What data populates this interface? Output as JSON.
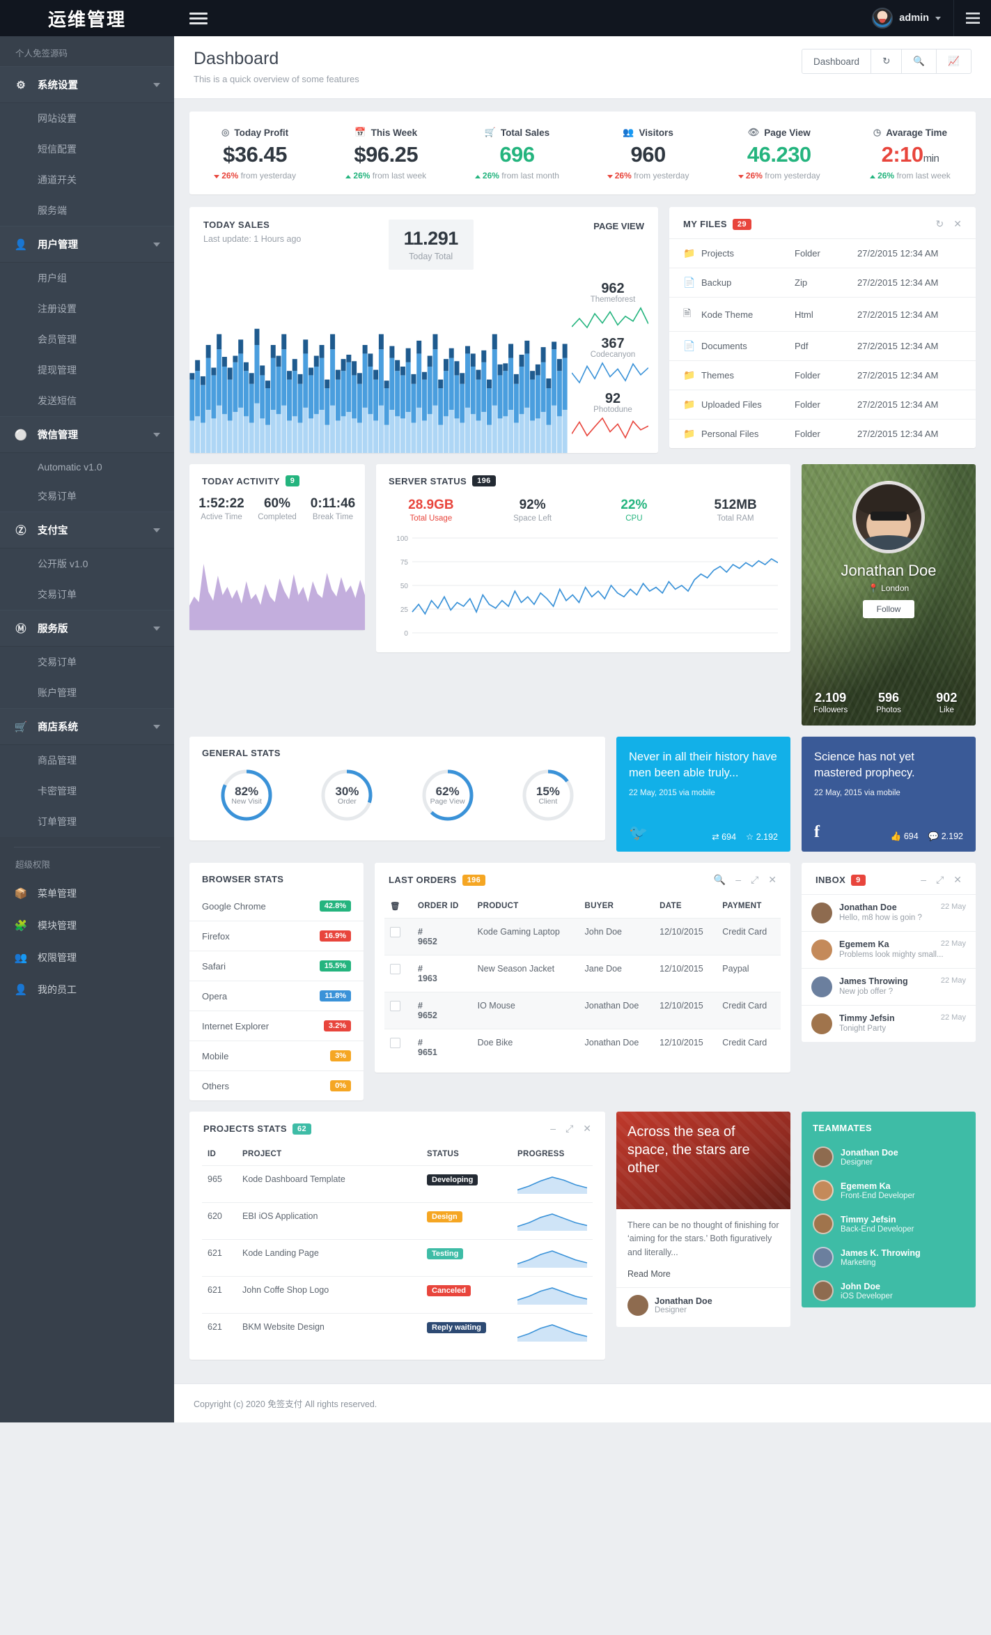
{
  "brand": {
    "title": "运维管理"
  },
  "topbar": {
    "hamburger_icon": "hamburger-icon",
    "user_name": "admin",
    "right_toggle_icon": "panel-toggle-icon"
  },
  "sidebar": {
    "top_label": "个人免签源码",
    "super_label": "超级权限",
    "groups": [
      {
        "icon": "gear-icon",
        "label": "系统设置",
        "items": [
          "网站设置",
          "短信配置",
          "通道开关",
          "服务端"
        ]
      },
      {
        "icon": "user-icon",
        "label": "用户管理",
        "items": [
          "用户组",
          "注册设置",
          "会员管理",
          "提现管理",
          "发送短信"
        ]
      },
      {
        "icon": "wechat-icon",
        "label": "微信管理",
        "items": [
          "Automatic v1.0",
          "交易订单"
        ]
      },
      {
        "icon": "alipay-icon",
        "label": "支付宝",
        "items": [
          "公开版 v1.0",
          "交易订单"
        ]
      },
      {
        "icon": "paypal-icon",
        "label": "服务版",
        "items": [
          "交易订单",
          "账户管理"
        ]
      },
      {
        "icon": "cart-icon",
        "label": "商店系统",
        "items": [
          "商品管理",
          "卡密管理",
          "订单管理"
        ]
      }
    ],
    "flat_items": [
      {
        "icon": "box-icon",
        "label": "菜单管理"
      },
      {
        "icon": "puzzle-icon",
        "label": "模块管理"
      },
      {
        "icon": "users-icon",
        "label": "权限管理"
      },
      {
        "icon": "employee-icon",
        "label": "我的员工"
      }
    ]
  },
  "page": {
    "title": "Dashboard",
    "subtitle": "This is a quick overview of some features",
    "buttons": [
      "Dashboard"
    ],
    "tool_icons": [
      "refresh-icon",
      "search-icon",
      "chart-icon"
    ]
  },
  "stats": [
    {
      "icon": "target-icon",
      "label": "Today Profit",
      "value": "$36.45",
      "value_color": "dark",
      "dir": "down",
      "pct": "26%",
      "note": "from yesterday"
    },
    {
      "icon": "calendar-icon",
      "label": "This Week",
      "value": "$96.25",
      "value_color": "dark",
      "dir": "up",
      "pct": "26%",
      "note": "from last week"
    },
    {
      "icon": "cart-icon",
      "label": "Total Sales",
      "value": "696",
      "value_color": "green",
      "dir": "up",
      "pct": "26%",
      "note": "from last month"
    },
    {
      "icon": "visitors-icon",
      "label": "Visitors",
      "value": "960",
      "value_color": "dark",
      "dir": "down",
      "pct": "26%",
      "note": "from yesterday"
    },
    {
      "icon": "eye-icon",
      "label": "Page View",
      "value": "46.230",
      "value_color": "green",
      "dir": "down",
      "pct": "26%",
      "note": "from yesterday"
    },
    {
      "icon": "clock-icon",
      "label": "Avarage Time",
      "value": "2:10",
      "value_suffix": "min",
      "value_color": "red",
      "dir": "up",
      "pct": "26%",
      "note": "from last week"
    }
  ],
  "today_sales": {
    "title": "TODAY SALES",
    "subtitle": "Last update: 1 Hours ago",
    "total_value": "11.291",
    "total_label": "Today Total"
  },
  "page_view": {
    "title": "PAGE VIEW",
    "items": [
      {
        "value": "962",
        "label": "Themeforest",
        "color": "#24b47e"
      },
      {
        "value": "367",
        "label": "Codecanyon",
        "color": "#3a92d8"
      },
      {
        "value": "92",
        "label": "Photodune",
        "color": "#e8453c"
      }
    ]
  },
  "my_files": {
    "title": "MY FILES",
    "badge": "29",
    "tool_icons": [
      "refresh-icon",
      "close-icon"
    ],
    "rows": [
      {
        "icon": "folder-icon",
        "name": "Projects",
        "type": "Folder",
        "date": "27/2/2015 12:34 AM"
      },
      {
        "icon": "file-icon",
        "name": "Backup",
        "type": "Zip",
        "date": "27/2/2015 12:34 AM"
      },
      {
        "icon": "code-icon",
        "name": "Kode Theme",
        "type": "Html",
        "date": "27/2/2015 12:34 AM"
      },
      {
        "icon": "file-icon",
        "name": "Documents",
        "type": "Pdf",
        "date": "27/2/2015 12:34 AM"
      },
      {
        "icon": "folder-icon",
        "name": "Themes",
        "type": "Folder",
        "date": "27/2/2015 12:34 AM"
      },
      {
        "icon": "folder-icon",
        "name": "Uploaded Files",
        "type": "Folder",
        "date": "27/2/2015 12:34 AM"
      },
      {
        "icon": "folder-icon",
        "name": "Personal Files",
        "type": "Folder",
        "date": "27/2/2015 12:34 AM"
      }
    ]
  },
  "today_activity": {
    "title": "TODAY ACTIVITY",
    "badge": "9",
    "metrics": [
      {
        "value": "1:52:22",
        "label": "Active Time"
      },
      {
        "value": "60%",
        "label": "Completed"
      },
      {
        "value": "0:11:46",
        "label": "Break Time"
      }
    ]
  },
  "server_status": {
    "title": "SERVER STATUS",
    "badge": "196",
    "metrics": [
      {
        "value": "28.9GB",
        "label": "Total Usage",
        "color": "#e8453c"
      },
      {
        "value": "92%",
        "label": "Space Left",
        "color": "#2f3740"
      },
      {
        "value": "22%",
        "label": "CPU",
        "color": "#24b47e"
      },
      {
        "value": "512MB",
        "label": "Total RAM",
        "color": "#2f3740"
      }
    ],
    "y_ticks": [
      "100",
      "75",
      "50",
      "25",
      "0"
    ]
  },
  "profile": {
    "name": "Jonathan Doe",
    "location": "London",
    "location_icon": "pin-icon",
    "follow_label": "Follow",
    "stats": [
      {
        "value": "2.109",
        "label": "Followers"
      },
      {
        "value": "596",
        "label": "Photos"
      },
      {
        "value": "902",
        "label": "Like"
      }
    ]
  },
  "general_stats": {
    "title": "GENERAL STATS",
    "donuts": [
      {
        "pct": "82%",
        "label": "New Visit",
        "value": 82,
        "color": "#3a92d8"
      },
      {
        "pct": "30%",
        "label": "Order",
        "value": 30,
        "color": "#3a92d8"
      },
      {
        "pct": "62%",
        "label": "Page View",
        "value": 62,
        "color": "#3a92d8"
      },
      {
        "pct": "15%",
        "label": "Client",
        "value": 15,
        "color": "#3a92d8"
      }
    ]
  },
  "twitter_card": {
    "text": "Never in all their history have men been able truly...",
    "date": "22 May, 2015 via mobile",
    "icon": "twitter-icon",
    "retweet_icon": "retweet-icon",
    "retweets": "694",
    "fav_icon": "star-icon",
    "favorites": "2.192",
    "color": "#12b0e8"
  },
  "facebook_card": {
    "text": "Science has not yet mastered prophecy.",
    "date": "22 May, 2015 via mobile",
    "icon": "facebook-icon",
    "like_icon": "thumbs-up-icon",
    "likes": "694",
    "comment_icon": "comment-icon",
    "comments": "2.192",
    "color": "#3a5a97"
  },
  "browser_stats": {
    "title": "BROWSER STATS",
    "rows": [
      {
        "name": "Google Chrome",
        "pct": "42.8%",
        "color": "#24b47e"
      },
      {
        "name": "Firefox",
        "pct": "16.9%",
        "color": "#e8453c"
      },
      {
        "name": "Safari",
        "pct": "15.5%",
        "color": "#24b47e"
      },
      {
        "name": "Opera",
        "pct": "11.8%",
        "color": "#3a92d8"
      },
      {
        "name": "Internet Explorer",
        "pct": "3.2%",
        "color": "#e8453c"
      },
      {
        "name": "Mobile",
        "pct": "3%",
        "color": "#f5a623"
      },
      {
        "name": "Others",
        "pct": "0%",
        "color": "#f5a623"
      }
    ]
  },
  "last_orders": {
    "title": "LAST ORDERS",
    "badge": "196",
    "tool_icons": [
      "search-icon",
      "minimize-icon",
      "expand-icon",
      "close-icon"
    ],
    "delete_icon": "trash-icon",
    "columns": [
      "ORDER ID",
      "PRODUCT",
      "BUYER",
      "DATE",
      "PAYMENT"
    ],
    "rows": [
      {
        "id": "# 9652",
        "product": "Kode Gaming Laptop",
        "buyer": "John Doe",
        "date": "12/10/2015",
        "payment": "Credit Card"
      },
      {
        "id": "# 1963",
        "product": "New Season Jacket",
        "buyer": "Jane Doe",
        "date": "12/10/2015",
        "payment": "Paypal"
      },
      {
        "id": "# 9652",
        "product": "IO Mouse",
        "buyer": "Jonathan Doe",
        "date": "12/10/2015",
        "payment": "Credit Card"
      },
      {
        "id": "# 9651",
        "product": "Doe Bike",
        "buyer": "Jonathan Doe",
        "date": "12/10/2015",
        "payment": "Credit Card"
      }
    ]
  },
  "inbox": {
    "title": "INBOX",
    "badge": "9",
    "tool_icons": [
      "minimize-icon",
      "expand-icon",
      "close-icon"
    ],
    "rows": [
      {
        "name": "Jonathan Doe",
        "msg": "Hello, m8 how is goin ?",
        "time": "22 May",
        "color": "#8e6b4f"
      },
      {
        "name": "Egemem Ka",
        "msg": "Problems look mighty small...",
        "time": "22 May",
        "color": "#c48a5a"
      },
      {
        "name": "James Throwing",
        "msg": "New job offer ?",
        "time": "22 May",
        "color": "#6b7f9e"
      },
      {
        "name": "Timmy Jefsin",
        "msg": "Tonight Party",
        "time": "22 May",
        "color": "#a0744c"
      }
    ]
  },
  "projects_stats": {
    "title": "PROJECTS STATS",
    "badge": "62",
    "tool_icons": [
      "minimize-icon",
      "expand-icon",
      "close-icon"
    ],
    "columns": [
      "ID",
      "PROJECT",
      "STATUS",
      "PROGRESS"
    ],
    "rows": [
      {
        "id": "965",
        "project": "Kode Dashboard Template",
        "status": "Developing",
        "status_color": "#232a33"
      },
      {
        "id": "620",
        "project": "EBI iOS Application",
        "status": "Design",
        "status_color": "#f5a623"
      },
      {
        "id": "621",
        "project": "Kode Landing Page",
        "status": "Testing",
        "status_color": "#3ebca6"
      },
      {
        "id": "621",
        "project": "John Coffe Shop Logo",
        "status": "Canceled",
        "status_color": "#e8453c"
      },
      {
        "id": "621",
        "project": "BKM Website Design",
        "status": "Reply waiting",
        "status_color": "#2d4a73"
      }
    ]
  },
  "quote_card": {
    "headline": "Across the sea of space, the stars are other",
    "body": "There can be no thought of finishing for ‘aiming for the stars.’  Both figuratively and literally...",
    "read_more": "Read More",
    "author": "Jonathan Doe",
    "author_role": "Designer"
  },
  "teammates": {
    "title": "TEAMMATES",
    "rows": [
      {
        "name": "Jonathan Doe",
        "role": "Designer",
        "color": "#8e6b4f"
      },
      {
        "name": "Egemem Ka",
        "role": "Front-End Developer",
        "color": "#c48a5a"
      },
      {
        "name": "Timmy Jefsin",
        "role": "Back-End Developer",
        "color": "#a0744c"
      },
      {
        "name": "James K. Throwing",
        "role": "Marketing",
        "color": "#6b7f9e"
      },
      {
        "name": "John Doe",
        "role": "iOS Developer",
        "color": "#8e6b4f"
      }
    ]
  },
  "footer": {
    "text": "Copyright (c) 2020 免签支付 All rights reserved."
  },
  "chart_data": [
    {
      "type": "bar",
      "title": "TODAY SALES",
      "stacked": true,
      "series": [
        {
          "name": "dark",
          "color": "#1e5a8e",
          "values": [
            6,
            10,
            8,
            12,
            7,
            14,
            9,
            11,
            6,
            13,
            8,
            10,
            15,
            9,
            7,
            12,
            10,
            14,
            8,
            11,
            9,
            13,
            7,
            10,
            12,
            8,
            14,
            9,
            11,
            7,
            13,
            10,
            8,
            12,
            9,
            14,
            7,
            11,
            10,
            8,
            13,
            9,
            12,
            7,
            10,
            14,
            8,
            11,
            9,
            13,
            10,
            7,
            12,
            9,
            11,
            8,
            14,
            10,
            7,
            13,
            9,
            11,
            12,
            8,
            10,
            14,
            9,
            7,
            11,
            13
          ]
        },
        {
          "name": "mid",
          "color": "#4a9ede",
          "values": [
            38,
            42,
            35,
            48,
            40,
            52,
            44,
            38,
            46,
            50,
            42,
            36,
            54,
            40,
            34,
            48,
            44,
            52,
            38,
            42,
            36,
            50,
            40,
            44,
            48,
            34,
            52,
            38,
            42,
            46,
            40,
            36,
            50,
            44,
            38,
            52,
            34,
            48,
            42,
            40,
            46,
            36,
            50,
            38,
            44,
            52,
            34,
            42,
            48,
            40,
            36,
            50,
            44,
            38,
            46,
            34,
            52,
            40,
            42,
            48,
            36,
            44,
            50,
            38,
            40,
            46,
            34,
            52,
            42,
            48
          ]
        },
        {
          "name": "light",
          "color": "#aed6f5",
          "values": [
            30,
            34,
            28,
            40,
            32,
            44,
            36,
            30,
            38,
            42,
            34,
            28,
            46,
            32,
            26,
            40,
            36,
            44,
            30,
            34,
            28,
            42,
            32,
            36,
            40,
            26,
            44,
            30,
            34,
            38,
            32,
            28,
            42,
            36,
            30,
            44,
            26,
            40,
            34,
            32,
            38,
            28,
            42,
            30,
            36,
            44,
            26,
            34,
            40,
            32,
            28,
            42,
            36,
            30,
            38,
            26,
            44,
            32,
            34,
            40,
            28,
            36,
            42,
            30,
            32,
            38,
            26,
            44,
            34,
            40
          ]
        }
      ],
      "xlabel": "",
      "ylabel": ""
    },
    {
      "type": "line",
      "title": "PAGE VIEW sparklines",
      "series": [
        {
          "name": "Themeforest",
          "color": "#24b47e",
          "value": 962,
          "values": [
            20,
            42,
            18,
            55,
            30,
            60,
            25,
            48,
            35,
            70,
            28
          ]
        },
        {
          "name": "Codecanyon",
          "color": "#3a92d8",
          "value": 367,
          "values": [
            45,
            20,
            62,
            30,
            70,
            35,
            55,
            25,
            68,
            40,
            58
          ]
        },
        {
          "name": "Photodune",
          "color": "#e8453c",
          "value": 92,
          "values": [
            30,
            60,
            25,
            48,
            70,
            35,
            55,
            20,
            62,
            40,
            50
          ]
        }
      ]
    },
    {
      "type": "area",
      "title": "TODAY ACTIVITY",
      "color": "#c3aedd",
      "values": [
        35,
        48,
        40,
        95,
        55,
        42,
        78,
        50,
        62,
        45,
        58,
        38,
        70,
        44,
        52,
        36,
        66,
        48,
        40,
        74,
        56,
        44,
        80,
        50,
        62,
        40,
        70,
        52,
        46,
        82,
        58,
        48,
        76,
        54,
        64,
        46,
        72,
        50
      ]
    },
    {
      "type": "line",
      "title": "SERVER STATUS",
      "color": "#3a92d8",
      "ylim": [
        0,
        100
      ],
      "yticks": [
        0,
        25,
        50,
        75,
        100
      ],
      "values": [
        22,
        30,
        20,
        34,
        26,
        38,
        24,
        32,
        28,
        36,
        22,
        40,
        30,
        26,
        34,
        28,
        44,
        32,
        38,
        30,
        42,
        36,
        28,
        46,
        34,
        40,
        32,
        48,
        38,
        44,
        36,
        50,
        42,
        38,
        46,
        40,
        52,
        44,
        48,
        42,
        54,
        46,
        50,
        44,
        56,
        62,
        58,
        66,
        70,
        64,
        72,
        68,
        74,
        70,
        76,
        72,
        78,
        74
      ]
    },
    {
      "type": "pie",
      "title": "GENERAL STATS",
      "labels": [
        "New Visit",
        "Order",
        "Page View",
        "Client"
      ],
      "values": [
        82,
        30,
        62,
        15
      ]
    },
    {
      "type": "bar",
      "title": "BROWSER STATS",
      "categories": [
        "Google Chrome",
        "Firefox",
        "Safari",
        "Opera",
        "Internet Explorer",
        "Mobile",
        "Others"
      ],
      "values": [
        42.8,
        16.9,
        15.5,
        11.8,
        3.2,
        3,
        0
      ]
    },
    {
      "type": "line",
      "title": "PROJECTS STATS progress sparklines",
      "series": [
        {
          "name": "965",
          "values": [
            10,
            25,
            45,
            60,
            48,
            30,
            18
          ]
        },
        {
          "name": "620",
          "values": [
            12,
            28,
            50,
            64,
            46,
            28,
            16
          ]
        },
        {
          "name": "621",
          "values": [
            10,
            26,
            48,
            62,
            44,
            26,
            14
          ]
        },
        {
          "name": "621",
          "values": [
            14,
            30,
            52,
            66,
            48,
            30,
            18
          ]
        },
        {
          "name": "621",
          "values": [
            11,
            27,
            49,
            63,
            45,
            27,
            15
          ]
        }
      ]
    }
  ]
}
